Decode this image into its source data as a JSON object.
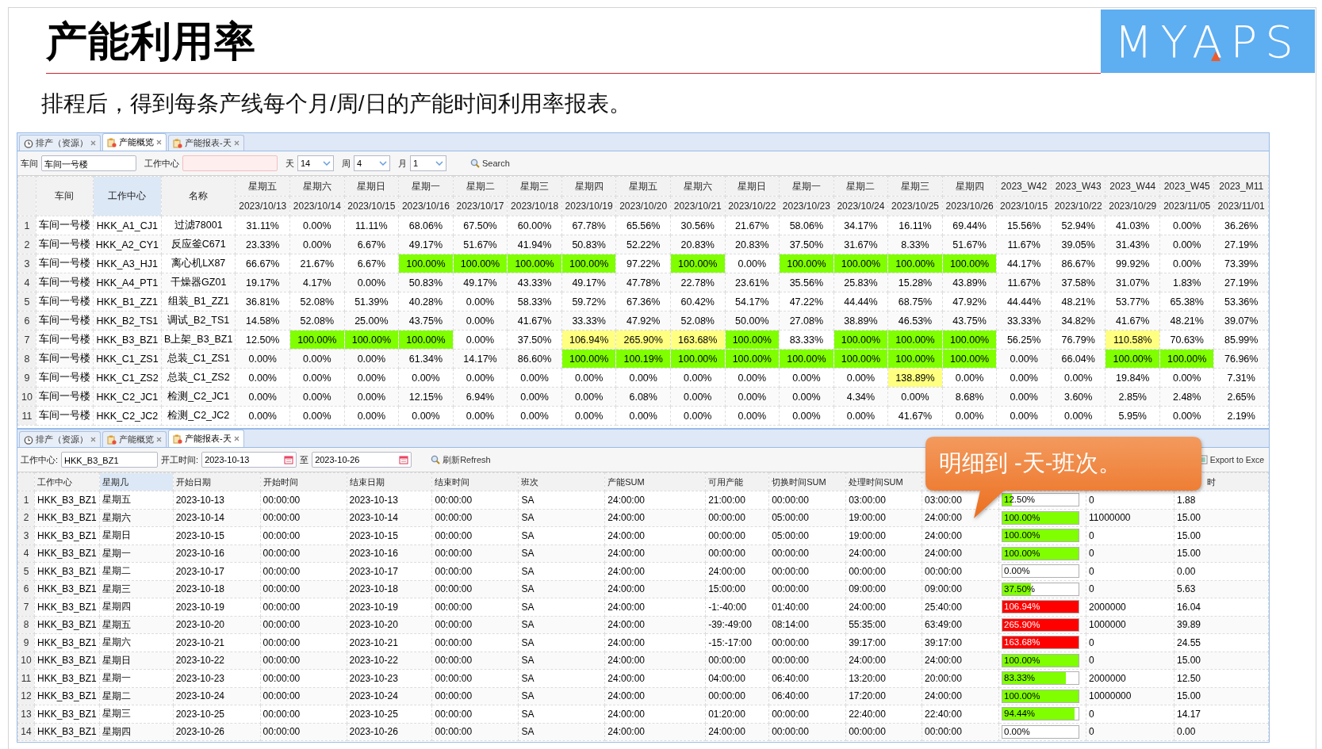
{
  "slide": {
    "title": "产能利用率",
    "logo": "MYAPS",
    "subtitle": "排程后，得到每条产线每个月/周/日的产能时间利用率报表。"
  },
  "overview_panel": {
    "tabs": [
      {
        "label": "排产（资源）",
        "kind": "clock",
        "selected": false
      },
      {
        "label": "产能概览",
        "kind": "report",
        "selected": true
      },
      {
        "label": "产能报表-天",
        "kind": "report",
        "selected": false
      }
    ],
    "toolbar": {
      "workshop_label": "车间",
      "workshop_value": "车间一号楼",
      "center_label": "工作中心",
      "center_invalid": true,
      "day_label": "天",
      "day_value": "14",
      "week_label": "周",
      "week_value": "4",
      "month_label": "月",
      "month_value": "1",
      "search": "Search"
    },
    "columns": [
      {
        "label": "车间",
        "sorted": false
      },
      {
        "label": "工作中心",
        "sorted": true
      },
      {
        "label": "名称",
        "sorted": false
      }
    ],
    "periods": [
      {
        "label": "星期五",
        "date": "2023/10/13"
      },
      {
        "label": "星期六",
        "date": "2023/10/14"
      },
      {
        "label": "星期日",
        "date": "2023/10/15"
      },
      {
        "label": "星期一",
        "date": "2023/10/16"
      },
      {
        "label": "星期二",
        "date": "2023/10/17"
      },
      {
        "label": "星期三",
        "date": "2023/10/18"
      },
      {
        "label": "星期四",
        "date": "2023/10/19"
      },
      {
        "label": "星期五",
        "date": "2023/10/20"
      },
      {
        "label": "星期六",
        "date": "2023/10/21"
      },
      {
        "label": "星期日",
        "date": "2023/10/22"
      },
      {
        "label": "星期一",
        "date": "2023/10/23"
      },
      {
        "label": "星期二",
        "date": "2023/10/24"
      },
      {
        "label": "星期三",
        "date": "2023/10/25"
      },
      {
        "label": "星期四",
        "date": "2023/10/26"
      },
      {
        "label": "2023_W42",
        "date": "2023/10/15"
      },
      {
        "label": "2023_W43",
        "date": "2023/10/22"
      },
      {
        "label": "2023_W44",
        "date": "2023/10/29"
      },
      {
        "label": "2023_W45",
        "date": "2023/11/05"
      },
      {
        "label": "2023_M11",
        "date": "2023/11/01"
      }
    ],
    "rows": [
      {
        "num": "1",
        "info": [
          "车间一号楼",
          "HKK_A1_CJ1",
          "过滤78001"
        ],
        "values": [
          {
            "text": "31.11%",
            "kind": "plain"
          },
          {
            "text": "0.00%",
            "kind": "plain"
          },
          {
            "text": "11.11%",
            "kind": "plain"
          },
          {
            "text": "68.06%",
            "kind": "plain"
          },
          {
            "text": "67.50%",
            "kind": "plain"
          },
          {
            "text": "60.00%",
            "kind": "plain"
          },
          {
            "text": "67.78%",
            "kind": "plain"
          },
          {
            "text": "65.56%",
            "kind": "plain"
          },
          {
            "text": "30.56%",
            "kind": "plain"
          },
          {
            "text": "21.67%",
            "kind": "plain"
          },
          {
            "text": "58.06%",
            "kind": "plain"
          },
          {
            "text": "34.17%",
            "kind": "plain"
          },
          {
            "text": "16.11%",
            "kind": "plain"
          },
          {
            "text": "69.44%",
            "kind": "plain"
          },
          {
            "text": "15.56%",
            "kind": "plain"
          },
          {
            "text": "52.94%",
            "kind": "plain"
          },
          {
            "text": "41.03%",
            "kind": "plain"
          },
          {
            "text": "0.00%",
            "kind": "plain"
          },
          {
            "text": "36.26%",
            "kind": "plain"
          }
        ]
      },
      {
        "num": "2",
        "info": [
          "车间一号楼",
          "HKK_A2_CY1",
          "反应釜C671"
        ],
        "values": [
          {
            "text": "23.33%",
            "kind": "plain"
          },
          {
            "text": "0.00%",
            "kind": "plain"
          },
          {
            "text": "6.67%",
            "kind": "plain"
          },
          {
            "text": "49.17%",
            "kind": "plain"
          },
          {
            "text": "51.67%",
            "kind": "plain"
          },
          {
            "text": "41.94%",
            "kind": "plain"
          },
          {
            "text": "50.83%",
            "kind": "plain"
          },
          {
            "text": "52.22%",
            "kind": "plain"
          },
          {
            "text": "20.83%",
            "kind": "plain"
          },
          {
            "text": "20.83%",
            "kind": "plain"
          },
          {
            "text": "37.50%",
            "kind": "plain"
          },
          {
            "text": "31.67%",
            "kind": "plain"
          },
          {
            "text": "8.33%",
            "kind": "plain"
          },
          {
            "text": "51.67%",
            "kind": "plain"
          },
          {
            "text": "11.67%",
            "kind": "plain"
          },
          {
            "text": "39.05%",
            "kind": "plain"
          },
          {
            "text": "31.43%",
            "kind": "plain"
          },
          {
            "text": "0.00%",
            "kind": "plain"
          },
          {
            "text": "27.19%",
            "kind": "plain"
          }
        ]
      },
      {
        "num": "3",
        "info": [
          "车间一号楼",
          "HKK_A3_HJ1",
          "离心机LX87"
        ],
        "values": [
          {
            "text": "66.67%",
            "kind": "plain"
          },
          {
            "text": "21.67%",
            "kind": "plain"
          },
          {
            "text": "6.67%",
            "kind": "plain"
          },
          {
            "text": "100.00%",
            "kind": "full"
          },
          {
            "text": "100.00%",
            "kind": "full"
          },
          {
            "text": "100.00%",
            "kind": "full"
          },
          {
            "text": "100.00%",
            "kind": "full"
          },
          {
            "text": "97.22%",
            "kind": "plain"
          },
          {
            "text": "100.00%",
            "kind": "full"
          },
          {
            "text": "0.00%",
            "kind": "plain"
          },
          {
            "text": "100.00%",
            "kind": "full"
          },
          {
            "text": "100.00%",
            "kind": "full"
          },
          {
            "text": "100.00%",
            "kind": "full"
          },
          {
            "text": "100.00%",
            "kind": "full"
          },
          {
            "text": "44.17%",
            "kind": "plain"
          },
          {
            "text": "86.67%",
            "kind": "plain"
          },
          {
            "text": "99.92%",
            "kind": "plain"
          },
          {
            "text": "0.00%",
            "kind": "plain"
          },
          {
            "text": "73.39%",
            "kind": "plain"
          }
        ]
      },
      {
        "num": "4",
        "info": [
          "车间一号楼",
          "HKK_A4_PT1",
          "干燥器GZ01"
        ],
        "values": [
          {
            "text": "19.17%",
            "kind": "plain"
          },
          {
            "text": "4.17%",
            "kind": "plain"
          },
          {
            "text": "0.00%",
            "kind": "plain"
          },
          {
            "text": "50.83%",
            "kind": "plain"
          },
          {
            "text": "49.17%",
            "kind": "plain"
          },
          {
            "text": "43.33%",
            "kind": "plain"
          },
          {
            "text": "49.17%",
            "kind": "plain"
          },
          {
            "text": "47.78%",
            "kind": "plain"
          },
          {
            "text": "22.78%",
            "kind": "plain"
          },
          {
            "text": "23.61%",
            "kind": "plain"
          },
          {
            "text": "35.56%",
            "kind": "plain"
          },
          {
            "text": "25.83%",
            "kind": "plain"
          },
          {
            "text": "15.28%",
            "kind": "plain"
          },
          {
            "text": "43.89%",
            "kind": "plain"
          },
          {
            "text": "11.67%",
            "kind": "plain"
          },
          {
            "text": "37.58%",
            "kind": "plain"
          },
          {
            "text": "31.07%",
            "kind": "plain"
          },
          {
            "text": "1.83%",
            "kind": "plain"
          },
          {
            "text": "27.19%",
            "kind": "plain"
          }
        ]
      },
      {
        "num": "5",
        "info": [
          "车间一号楼",
          "HKK_B1_ZZ1",
          "组装_B1_ZZ1"
        ],
        "values": [
          {
            "text": "36.81%",
            "kind": "plain"
          },
          {
            "text": "52.08%",
            "kind": "plain"
          },
          {
            "text": "51.39%",
            "kind": "plain"
          },
          {
            "text": "40.28%",
            "kind": "plain"
          },
          {
            "text": "0.00%",
            "kind": "plain"
          },
          {
            "text": "58.33%",
            "kind": "plain"
          },
          {
            "text": "59.72%",
            "kind": "plain"
          },
          {
            "text": "67.36%",
            "kind": "plain"
          },
          {
            "text": "60.42%",
            "kind": "plain"
          },
          {
            "text": "54.17%",
            "kind": "plain"
          },
          {
            "text": "47.22%",
            "kind": "plain"
          },
          {
            "text": "44.44%",
            "kind": "plain"
          },
          {
            "text": "68.75%",
            "kind": "plain"
          },
          {
            "text": "47.92%",
            "kind": "plain"
          },
          {
            "text": "44.44%",
            "kind": "plain"
          },
          {
            "text": "48.21%",
            "kind": "plain"
          },
          {
            "text": "53.77%",
            "kind": "plain"
          },
          {
            "text": "65.38%",
            "kind": "plain"
          },
          {
            "text": "53.36%",
            "kind": "plain"
          }
        ]
      },
      {
        "num": "6",
        "info": [
          "车间一号楼",
          "HKK_B2_TS1",
          "调试_B2_TS1"
        ],
        "values": [
          {
            "text": "14.58%",
            "kind": "plain"
          },
          {
            "text": "52.08%",
            "kind": "plain"
          },
          {
            "text": "25.00%",
            "kind": "plain"
          },
          {
            "text": "43.75%",
            "kind": "plain"
          },
          {
            "text": "0.00%",
            "kind": "plain"
          },
          {
            "text": "41.67%",
            "kind": "plain"
          },
          {
            "text": "33.33%",
            "kind": "plain"
          },
          {
            "text": "47.92%",
            "kind": "plain"
          },
          {
            "text": "52.08%",
            "kind": "plain"
          },
          {
            "text": "50.00%",
            "kind": "plain"
          },
          {
            "text": "27.08%",
            "kind": "plain"
          },
          {
            "text": "38.89%",
            "kind": "plain"
          },
          {
            "text": "46.53%",
            "kind": "plain"
          },
          {
            "text": "43.75%",
            "kind": "plain"
          },
          {
            "text": "33.33%",
            "kind": "plain"
          },
          {
            "text": "34.82%",
            "kind": "plain"
          },
          {
            "text": "41.67%",
            "kind": "plain"
          },
          {
            "text": "48.21%",
            "kind": "plain"
          },
          {
            "text": "39.07%",
            "kind": "plain"
          }
        ]
      },
      {
        "num": "7",
        "info": [
          "车间一号楼",
          "HKK_B3_BZ1",
          "B上架_B3_BZ1"
        ],
        "values": [
          {
            "text": "12.50%",
            "kind": "plain"
          },
          {
            "text": "100.00%",
            "kind": "full"
          },
          {
            "text": "100.00%",
            "kind": "full"
          },
          {
            "text": "100.00%",
            "kind": "full"
          },
          {
            "text": "0.00%",
            "kind": "plain"
          },
          {
            "text": "37.50%",
            "kind": "plain"
          },
          {
            "text": "106.94%",
            "kind": "over"
          },
          {
            "text": "265.90%",
            "kind": "over"
          },
          {
            "text": "163.68%",
            "kind": "over"
          },
          {
            "text": "100.00%",
            "kind": "full"
          },
          {
            "text": "83.33%",
            "kind": "plain"
          },
          {
            "text": "100.00%",
            "kind": "full"
          },
          {
            "text": "100.00%",
            "kind": "full"
          },
          {
            "text": "100.00%",
            "kind": "full"
          },
          {
            "text": "56.25%",
            "kind": "plain"
          },
          {
            "text": "76.79%",
            "kind": "plain"
          },
          {
            "text": "110.58%",
            "kind": "over"
          },
          {
            "text": "70.63%",
            "kind": "plain"
          },
          {
            "text": "85.99%",
            "kind": "plain"
          }
        ]
      },
      {
        "num": "8",
        "info": [
          "车间一号楼",
          "HKK_C1_ZS1",
          "总装_C1_ZS1"
        ],
        "values": [
          {
            "text": "0.00%",
            "kind": "plain"
          },
          {
            "text": "0.00%",
            "kind": "plain"
          },
          {
            "text": "0.00%",
            "kind": "plain"
          },
          {
            "text": "61.34%",
            "kind": "plain"
          },
          {
            "text": "14.17%",
            "kind": "plain"
          },
          {
            "text": "86.60%",
            "kind": "plain"
          },
          {
            "text": "100.00%",
            "kind": "full"
          },
          {
            "text": "100.19%",
            "kind": "full"
          },
          {
            "text": "100.00%",
            "kind": "full"
          },
          {
            "text": "100.00%",
            "kind": "full"
          },
          {
            "text": "100.00%",
            "kind": "full"
          },
          {
            "text": "100.00%",
            "kind": "full"
          },
          {
            "text": "100.00%",
            "kind": "full"
          },
          {
            "text": "100.00%",
            "kind": "full"
          },
          {
            "text": "0.00%",
            "kind": "plain"
          },
          {
            "text": "66.04%",
            "kind": "plain"
          },
          {
            "text": "100.00%",
            "kind": "full"
          },
          {
            "text": "100.00%",
            "kind": "full"
          },
          {
            "text": "76.96%",
            "kind": "plain"
          }
        ]
      },
      {
        "num": "9",
        "info": [
          "车间一号楼",
          "HKK_C1_ZS2",
          "总装_C1_ZS2"
        ],
        "values": [
          {
            "text": "0.00%",
            "kind": "plain"
          },
          {
            "text": "0.00%",
            "kind": "plain"
          },
          {
            "text": "0.00%",
            "kind": "plain"
          },
          {
            "text": "0.00%",
            "kind": "plain"
          },
          {
            "text": "0.00%",
            "kind": "plain"
          },
          {
            "text": "0.00%",
            "kind": "plain"
          },
          {
            "text": "0.00%",
            "kind": "plain"
          },
          {
            "text": "0.00%",
            "kind": "plain"
          },
          {
            "text": "0.00%",
            "kind": "plain"
          },
          {
            "text": "0.00%",
            "kind": "plain"
          },
          {
            "text": "0.00%",
            "kind": "plain"
          },
          {
            "text": "0.00%",
            "kind": "plain"
          },
          {
            "text": "138.89%",
            "kind": "over"
          },
          {
            "text": "0.00%",
            "kind": "plain"
          },
          {
            "text": "0.00%",
            "kind": "plain"
          },
          {
            "text": "0.00%",
            "kind": "plain"
          },
          {
            "text": "19.84%",
            "kind": "plain"
          },
          {
            "text": "0.00%",
            "kind": "plain"
          },
          {
            "text": "7.31%",
            "kind": "plain"
          }
        ]
      },
      {
        "num": "10",
        "info": [
          "车间一号楼",
          "HKK_C2_JC1",
          "检测_C2_JC1"
        ],
        "values": [
          {
            "text": "0.00%",
            "kind": "plain"
          },
          {
            "text": "0.00%",
            "kind": "plain"
          },
          {
            "text": "0.00%",
            "kind": "plain"
          },
          {
            "text": "12.15%",
            "kind": "plain"
          },
          {
            "text": "6.94%",
            "kind": "plain"
          },
          {
            "text": "0.00%",
            "kind": "plain"
          },
          {
            "text": "0.00%",
            "kind": "plain"
          },
          {
            "text": "6.08%",
            "kind": "plain"
          },
          {
            "text": "0.00%",
            "kind": "plain"
          },
          {
            "text": "0.00%",
            "kind": "plain"
          },
          {
            "text": "0.00%",
            "kind": "plain"
          },
          {
            "text": "4.34%",
            "kind": "plain"
          },
          {
            "text": "0.00%",
            "kind": "plain"
          },
          {
            "text": "8.68%",
            "kind": "plain"
          },
          {
            "text": "0.00%",
            "kind": "plain"
          },
          {
            "text": "3.60%",
            "kind": "plain"
          },
          {
            "text": "2.85%",
            "kind": "plain"
          },
          {
            "text": "2.48%",
            "kind": "plain"
          },
          {
            "text": "2.65%",
            "kind": "plain"
          }
        ]
      },
      {
        "num": "11",
        "info": [
          "车间一号楼",
          "HKK_C2_JC2",
          "检测_C2_JC2"
        ],
        "values": [
          {
            "text": "0.00%",
            "kind": "plain"
          },
          {
            "text": "0.00%",
            "kind": "plain"
          },
          {
            "text": "0.00%",
            "kind": "plain"
          },
          {
            "text": "0.00%",
            "kind": "plain"
          },
          {
            "text": "0.00%",
            "kind": "plain"
          },
          {
            "text": "0.00%",
            "kind": "plain"
          },
          {
            "text": "0.00%",
            "kind": "plain"
          },
          {
            "text": "0.00%",
            "kind": "plain"
          },
          {
            "text": "0.00%",
            "kind": "plain"
          },
          {
            "text": "0.00%",
            "kind": "plain"
          },
          {
            "text": "0.00%",
            "kind": "plain"
          },
          {
            "text": "0.00%",
            "kind": "plain"
          },
          {
            "text": "41.67%",
            "kind": "plain"
          },
          {
            "text": "0.00%",
            "kind": "plain"
          },
          {
            "text": "0.00%",
            "kind": "plain"
          },
          {
            "text": "0.00%",
            "kind": "plain"
          },
          {
            "text": "5.95%",
            "kind": "plain"
          },
          {
            "text": "0.00%",
            "kind": "plain"
          },
          {
            "text": "2.19%",
            "kind": "plain"
          }
        ]
      }
    ]
  },
  "daily_panel": {
    "tabs": [
      {
        "label": "排产（资源）",
        "kind": "clock",
        "selected": false
      },
      {
        "label": "产能概览",
        "kind": "report",
        "selected": false
      },
      {
        "label": "产能报表-天",
        "kind": "report",
        "selected": true
      }
    ],
    "toolbar": {
      "center_label": "工作中心:",
      "center_value": "HKK_B3_BZ1",
      "start_label": "开工时间:",
      "start_value": "2023-10-13",
      "to_label": "至",
      "end_value": "2023-10-26",
      "refresh": "刷新Refresh",
      "export": "Export to Exce"
    },
    "columns": [
      {
        "label": "工作中心",
        "sorted": false
      },
      {
        "label": "星期几",
        "sorted": true
      },
      {
        "label": "开始日期",
        "sorted": false
      },
      {
        "label": "开始时间",
        "sorted": false
      },
      {
        "label": "结束日期",
        "sorted": false
      },
      {
        "label": "结束时间",
        "sorted": false
      },
      {
        "label": "班次",
        "sorted": false
      },
      {
        "label": "产能SUM",
        "sorted": false
      },
      {
        "label": "可用产能",
        "sorted": false
      },
      {
        "label": "切换时间SUM",
        "sorted": false
      },
      {
        "label": "处理时间SUM",
        "sorted": false
      }
    ],
    "column_15": "时",
    "rows": [
      {
        "num": "1",
        "cells": [
          "HKK_B3_BZ1",
          "星期五",
          "2023-10-13",
          "00:00:00",
          "2023-10-13",
          "00:00:00",
          "SA",
          "24:00:00",
          "21:00:00",
          "00:00:00",
          "03:00:00",
          "03:00:00"
        ],
        "bar": {
          "text": "12.50%",
          "level": 0.125,
          "over": false
        },
        "tail": [
          "0",
          "1.88"
        ]
      },
      {
        "num": "2",
        "cells": [
          "HKK_B3_BZ1",
          "星期六",
          "2023-10-14",
          "00:00:00",
          "2023-10-14",
          "00:00:00",
          "SA",
          "24:00:00",
          "00:00:00",
          "05:00:00",
          "19:00:00",
          "24:00:00"
        ],
        "bar": {
          "text": "100.00%",
          "level": 1,
          "over": false
        },
        "tail": [
          "11000000",
          "15.00"
        ]
      },
      {
        "num": "3",
        "cells": [
          "HKK_B3_BZ1",
          "星期日",
          "2023-10-15",
          "00:00:00",
          "2023-10-15",
          "00:00:00",
          "SA",
          "24:00:00",
          "00:00:00",
          "05:00:00",
          "19:00:00",
          "24:00:00"
        ],
        "bar": {
          "text": "100.00%",
          "level": 1,
          "over": false
        },
        "tail": [
          "0",
          "15.00"
        ]
      },
      {
        "num": "4",
        "cells": [
          "HKK_B3_BZ1",
          "星期一",
          "2023-10-16",
          "00:00:00",
          "2023-10-16",
          "00:00:00",
          "SA",
          "24:00:00",
          "00:00:00",
          "00:00:00",
          "24:00:00",
          "24:00:00"
        ],
        "bar": {
          "text": "100.00%",
          "level": 1,
          "over": false
        },
        "tail": [
          "0",
          "15.00"
        ]
      },
      {
        "num": "5",
        "cells": [
          "HKK_B3_BZ1",
          "星期二",
          "2023-10-17",
          "00:00:00",
          "2023-10-17",
          "00:00:00",
          "SA",
          "24:00:00",
          "24:00:00",
          "00:00:00",
          "00:00:00",
          "00:00:00"
        ],
        "bar": {
          "text": "0.00%",
          "level": 0,
          "over": false
        },
        "tail": [
          "0",
          "0.00"
        ]
      },
      {
        "num": "6",
        "cells": [
          "HKK_B3_BZ1",
          "星期三",
          "2023-10-18",
          "00:00:00",
          "2023-10-18",
          "00:00:00",
          "SA",
          "24:00:00",
          "15:00:00",
          "00:00:00",
          "09:00:00",
          "09:00:00"
        ],
        "bar": {
          "text": "37.50%",
          "level": 0.375,
          "over": false
        },
        "tail": [
          "0",
          "5.63"
        ]
      },
      {
        "num": "7",
        "cells": [
          "HKK_B3_BZ1",
          "星期四",
          "2023-10-19",
          "00:00:00",
          "2023-10-19",
          "00:00:00",
          "SA",
          "24:00:00",
          "-1:-40:00",
          "01:40:00",
          "24:00:00",
          "25:40:00"
        ],
        "bar": {
          "text": "106.94%",
          "level": 1,
          "over": true
        },
        "tail": [
          "2000000",
          "16.04"
        ]
      },
      {
        "num": "8",
        "cells": [
          "HKK_B3_BZ1",
          "星期五",
          "2023-10-20",
          "00:00:00",
          "2023-10-20",
          "00:00:00",
          "SA",
          "24:00:00",
          "-39:-49:00",
          "08:14:00",
          "55:35:00",
          "63:49:00"
        ],
        "bar": {
          "text": "265.90%",
          "level": 1,
          "over": true
        },
        "tail": [
          "1000000",
          "39.89"
        ]
      },
      {
        "num": "9",
        "cells": [
          "HKK_B3_BZ1",
          "星期六",
          "2023-10-21",
          "00:00:00",
          "2023-10-21",
          "00:00:00",
          "SA",
          "24:00:00",
          "-15:-17:00",
          "00:00:00",
          "39:17:00",
          "39:17:00"
        ],
        "bar": {
          "text": "163.68%",
          "level": 1,
          "over": true
        },
        "tail": [
          "0",
          "24.55"
        ]
      },
      {
        "num": "10",
        "cells": [
          "HKK_B3_BZ1",
          "星期日",
          "2023-10-22",
          "00:00:00",
          "2023-10-22",
          "00:00:00",
          "SA",
          "24:00:00",
          "00:00:00",
          "00:00:00",
          "24:00:00",
          "24:00:00"
        ],
        "bar": {
          "text": "100.00%",
          "level": 1,
          "over": false
        },
        "tail": [
          "0",
          "15.00"
        ]
      },
      {
        "num": "11",
        "cells": [
          "HKK_B3_BZ1",
          "星期一",
          "2023-10-23",
          "00:00:00",
          "2023-10-23",
          "00:00:00",
          "SA",
          "24:00:00",
          "04:00:00",
          "06:40:00",
          "13:20:00",
          "20:00:00"
        ],
        "bar": {
          "text": "83.33%",
          "level": 0.8333,
          "over": false
        },
        "tail": [
          "2000000",
          "12.50"
        ]
      },
      {
        "num": "12",
        "cells": [
          "HKK_B3_BZ1",
          "星期二",
          "2023-10-24",
          "00:00:00",
          "2023-10-24",
          "00:00:00",
          "SA",
          "24:00:00",
          "00:00:00",
          "06:40:00",
          "17:20:00",
          "24:00:00"
        ],
        "bar": {
          "text": "100.00%",
          "level": 1,
          "over": false
        },
        "tail": [
          "10000000",
          "15.00"
        ]
      },
      {
        "num": "13",
        "cells": [
          "HKK_B3_BZ1",
          "星期三",
          "2023-10-25",
          "00:00:00",
          "2023-10-25",
          "00:00:00",
          "SA",
          "24:00:00",
          "01:20:00",
          "00:00:00",
          "22:40:00",
          "22:40:00"
        ],
        "bar": {
          "text": "94.44%",
          "level": 0.9444,
          "over": false
        },
        "tail": [
          "0",
          "14.17"
        ]
      },
      {
        "num": "14",
        "cells": [
          "HKK_B3_BZ1",
          "星期四",
          "2023-10-26",
          "00:00:00",
          "2023-10-26",
          "00:00:00",
          "SA",
          "24:00:00",
          "24:00:00",
          "00:00:00",
          "00:00:00",
          "00:00:00"
        ],
        "bar": {
          "text": "0.00%",
          "level": 0,
          "over": false
        },
        "tail": [
          "0",
          "0.00"
        ]
      }
    ]
  },
  "callout": "明细到 -天-班次。"
}
